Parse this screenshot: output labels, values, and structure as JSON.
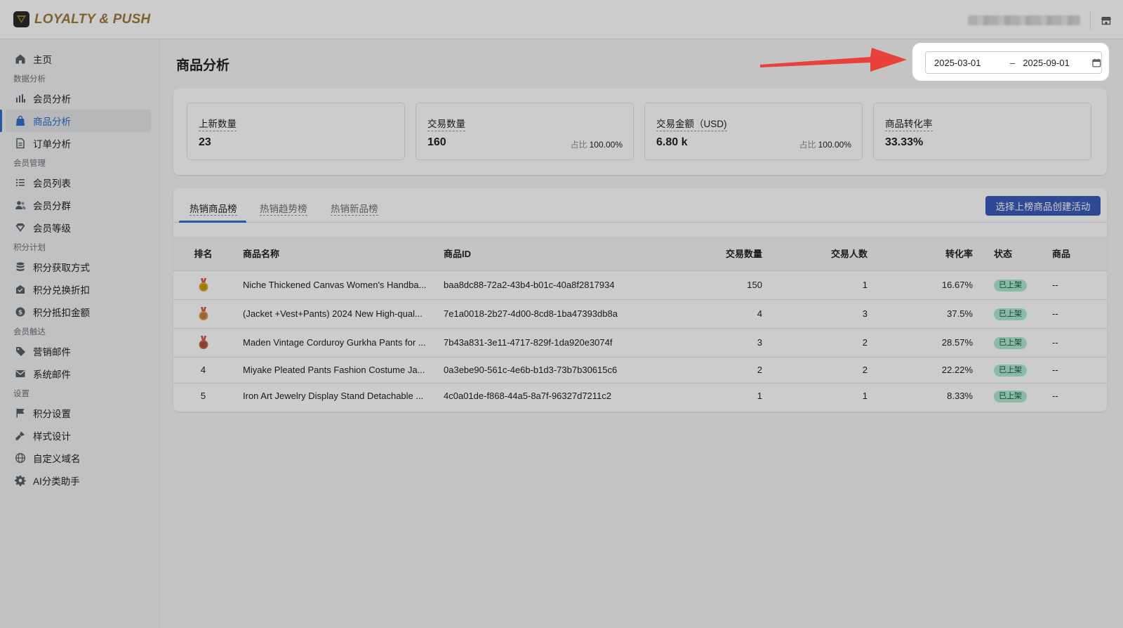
{
  "brand": {
    "name": "LOYALTY & PUSH"
  },
  "sidebar": {
    "home": "主页",
    "sections": [
      {
        "title": "数据分析",
        "items": [
          {
            "label": "会员分析",
            "icon": "bar-chart-icon"
          },
          {
            "label": "商品分析",
            "icon": "shopping-bag-icon",
            "active": true
          },
          {
            "label": "订单分析",
            "icon": "document-icon"
          }
        ]
      },
      {
        "title": "会员管理",
        "items": [
          {
            "label": "会员列表",
            "icon": "list-icon"
          },
          {
            "label": "会员分群",
            "icon": "users-icon"
          },
          {
            "label": "会员等级",
            "icon": "diamond-icon"
          }
        ]
      },
      {
        "title": "积分计划",
        "items": [
          {
            "label": "积分获取方式",
            "icon": "database-icon"
          },
          {
            "label": "积分兑换折扣",
            "icon": "discount-icon"
          },
          {
            "label": "积分抵扣金额",
            "icon": "dollar-icon"
          }
        ]
      },
      {
        "title": "会员触达",
        "items": [
          {
            "label": "营销邮件",
            "icon": "tag-icon"
          },
          {
            "label": "系统邮件",
            "icon": "mail-icon"
          }
        ]
      },
      {
        "title": "设置",
        "items": [
          {
            "label": "积分设置",
            "icon": "flag-icon"
          },
          {
            "label": "样式设计",
            "icon": "brush-icon"
          },
          {
            "label": "自定义域名",
            "icon": "globe-icon"
          },
          {
            "label": "AI分类助手",
            "icon": "gear-icon"
          }
        ]
      }
    ]
  },
  "page": {
    "title": "商品分析"
  },
  "date_range": {
    "start": "2025-03-01",
    "separator": "–",
    "end": "2025-09-01"
  },
  "stats": [
    {
      "label": "上新数量",
      "value": "23"
    },
    {
      "label": "交易数量",
      "value": "160",
      "ratio_label": "占比",
      "ratio": "100.00%"
    },
    {
      "label": "交易金额（USD)",
      "value": "6.80 k",
      "ratio_label": "占比",
      "ratio": "100.00%"
    },
    {
      "label": "商品转化率",
      "value": "33.33%"
    }
  ],
  "tabs": [
    "热销商品榜",
    "热销趋势榜",
    "热销新品榜"
  ],
  "create_button": "选择上榜商品创建活动",
  "table": {
    "headers": [
      "排名",
      "商品名称",
      "商品ID",
      "交易数量",
      "交易人数",
      "转化率",
      "状态",
      "商品"
    ],
    "rows": [
      {
        "rank": "1",
        "medal": "gold",
        "name": "Niche Thickened Canvas Women's Handba...",
        "id": "baa8dc88-72a2-43b4-b01c-40a8f2817934",
        "qty": "150",
        "buyers": "1",
        "rate": "16.67%",
        "status": "已上架",
        "more": "--"
      },
      {
        "rank": "2",
        "medal": "silver",
        "name": "(Jacket +Vest+Pants) 2024 New High-qual...",
        "id": "7e1a0018-2b27-4d00-8cd8-1ba47393db8a",
        "qty": "4",
        "buyers": "3",
        "rate": "37.5%",
        "status": "已上架",
        "more": "--"
      },
      {
        "rank": "3",
        "medal": "bronze",
        "name": "Maden Vintage Corduroy Gurkha Pants for ...",
        "id": "7b43a831-3e11-4717-829f-1da920e3074f",
        "qty": "3",
        "buyers": "2",
        "rate": "28.57%",
        "status": "已上架",
        "more": "--"
      },
      {
        "rank": "4",
        "medal": "",
        "name": "Miyake Pleated Pants Fashion Costume Ja...",
        "id": "0a3ebe90-561c-4e6b-b1d3-73b7b30615c6",
        "qty": "2",
        "buyers": "2",
        "rate": "22.22%",
        "status": "已上架",
        "more": "--"
      },
      {
        "rank": "5",
        "medal": "",
        "name": "Iron Art Jewelry Display Stand Detachable ...",
        "id": "4c0a01de-f868-44a5-8a7f-96327d7211c2",
        "qty": "1",
        "buyers": "1",
        "rate": "8.33%",
        "status": "已上架",
        "more": "--"
      }
    ]
  },
  "colors": {
    "accent": "#2c6ecb",
    "primary_button": "#3a5bb8",
    "brand_gold": "#a07b3c",
    "annotation_arrow": "#e8403a",
    "status_badge": "#aee9d1"
  }
}
